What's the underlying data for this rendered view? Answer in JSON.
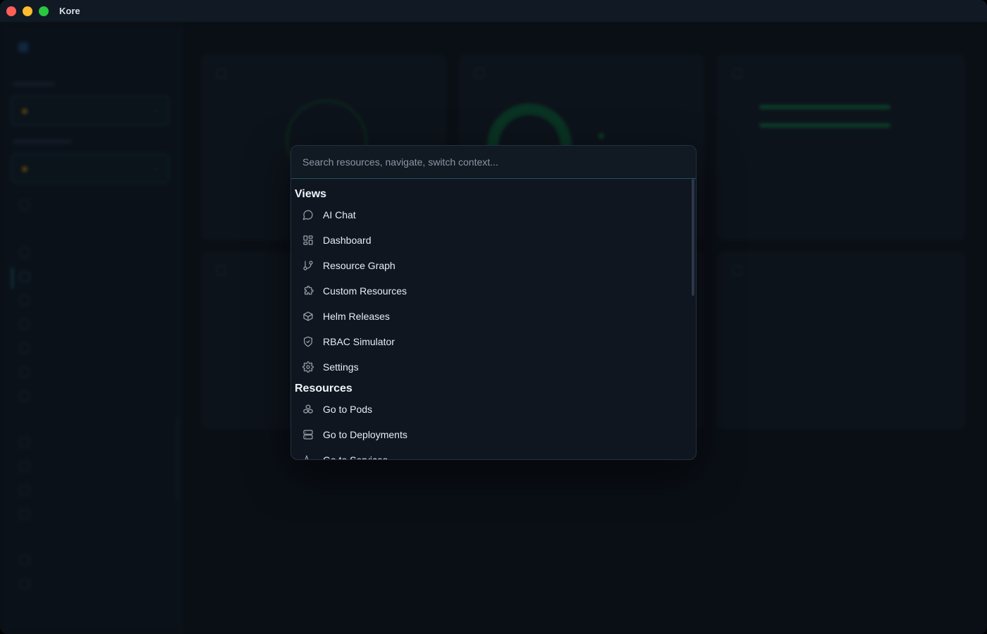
{
  "window": {
    "title": "Kore"
  },
  "palette": {
    "placeholder": "Search resources, navigate, switch context...",
    "groups": [
      {
        "heading": "Views",
        "items": [
          {
            "label": "AI Chat",
            "icon": "chat-bubble-icon"
          },
          {
            "label": "Dashboard",
            "icon": "grid-icon"
          },
          {
            "label": "Resource Graph",
            "icon": "git-branch-icon"
          },
          {
            "label": "Custom Resources",
            "icon": "puzzle-icon"
          },
          {
            "label": "Helm Releases",
            "icon": "package-cube-icon"
          },
          {
            "label": "RBAC Simulator",
            "icon": "shield-check-icon"
          },
          {
            "label": "Settings",
            "icon": "gear-icon"
          }
        ]
      },
      {
        "heading": "Resources",
        "items": [
          {
            "label": "Go to Pods",
            "icon": "boxes-icon"
          },
          {
            "label": "Go to Deployments",
            "icon": "server-icon"
          },
          {
            "label": "Go to Services",
            "icon": "activity-icon"
          }
        ]
      }
    ]
  },
  "colors": {
    "accent": "#1c5566",
    "background": "#0b1017",
    "palette_bg": "#0f1620",
    "text": "#e6edf3",
    "placeholder": "#8b97a5"
  }
}
